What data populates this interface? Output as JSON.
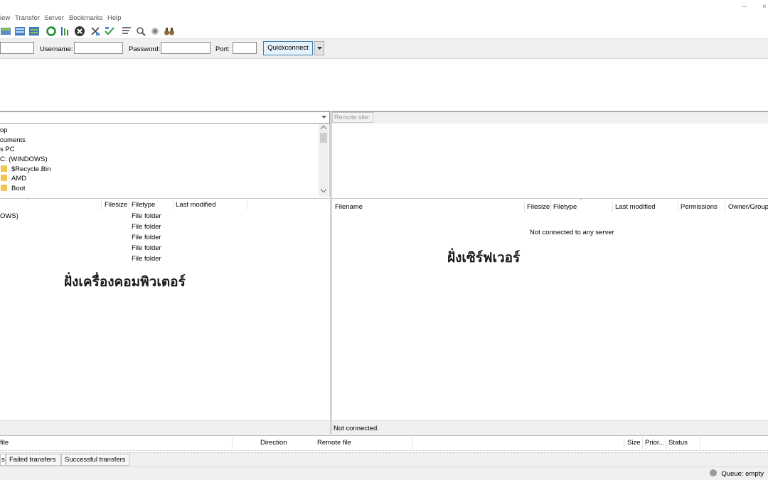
{
  "menu": {
    "items": [
      "iew",
      "Transfer",
      "Server",
      "Bookmarks",
      "Help"
    ],
    "window_controls": [
      "–",
      "×"
    ]
  },
  "toolbar": {
    "icons": [
      "site-manager-icon",
      "toggle-log-icon",
      "toggle-tree-icon",
      "refresh-icon",
      "process-queue-icon",
      "cancel-icon",
      "disconnect-icon",
      "reconnect-icon",
      "filter-icon",
      "compare-icon",
      "sync-browse-icon",
      "search-icon"
    ]
  },
  "quickconnect": {
    "username_label": "Username:",
    "password_label": "Password:",
    "port_label": "Port:",
    "button_label": "Quickconnect"
  },
  "local": {
    "tree": [
      {
        "label": "op",
        "icon": false
      },
      {
        "label": "cuments",
        "icon": false
      },
      {
        "label": "s PC",
        "icon": false
      },
      {
        "label": "C: (WINDOWS)",
        "icon": false
      },
      {
        "label": "$Recycle.Bin",
        "icon": true
      },
      {
        "label": "AMD",
        "icon": true
      },
      {
        "label": "Boot",
        "icon": true
      }
    ],
    "columns": [
      "Filesize",
      "Filetype",
      "Last modified"
    ],
    "rows": [
      {
        "name": "OWS)",
        "type": "File folder"
      },
      {
        "name": "",
        "type": "File folder"
      },
      {
        "name": "",
        "type": "File folder"
      },
      {
        "name": "",
        "type": "File folder"
      },
      {
        "name": "",
        "type": "File folder"
      }
    ],
    "annotation": "ฝั่งเครื่องคอมพิวเตอร์"
  },
  "remote": {
    "site_label": "Remote site:",
    "columns": [
      "Filename",
      "Filesize",
      "Filetype",
      "Last modified",
      "Permissions",
      "Owner/Group"
    ],
    "empty_message": "Not connected to any server",
    "status": "Not connected.",
    "annotation": "ฝั่งเซิร์ฟเวอร์"
  },
  "queue": {
    "columns": [
      "file",
      "Direction",
      "Remote file",
      "Size",
      "Prior...",
      "Status"
    ],
    "tabs": [
      "s",
      "Failed transfers",
      "Successful transfers"
    ],
    "status": "Queue: empty"
  }
}
